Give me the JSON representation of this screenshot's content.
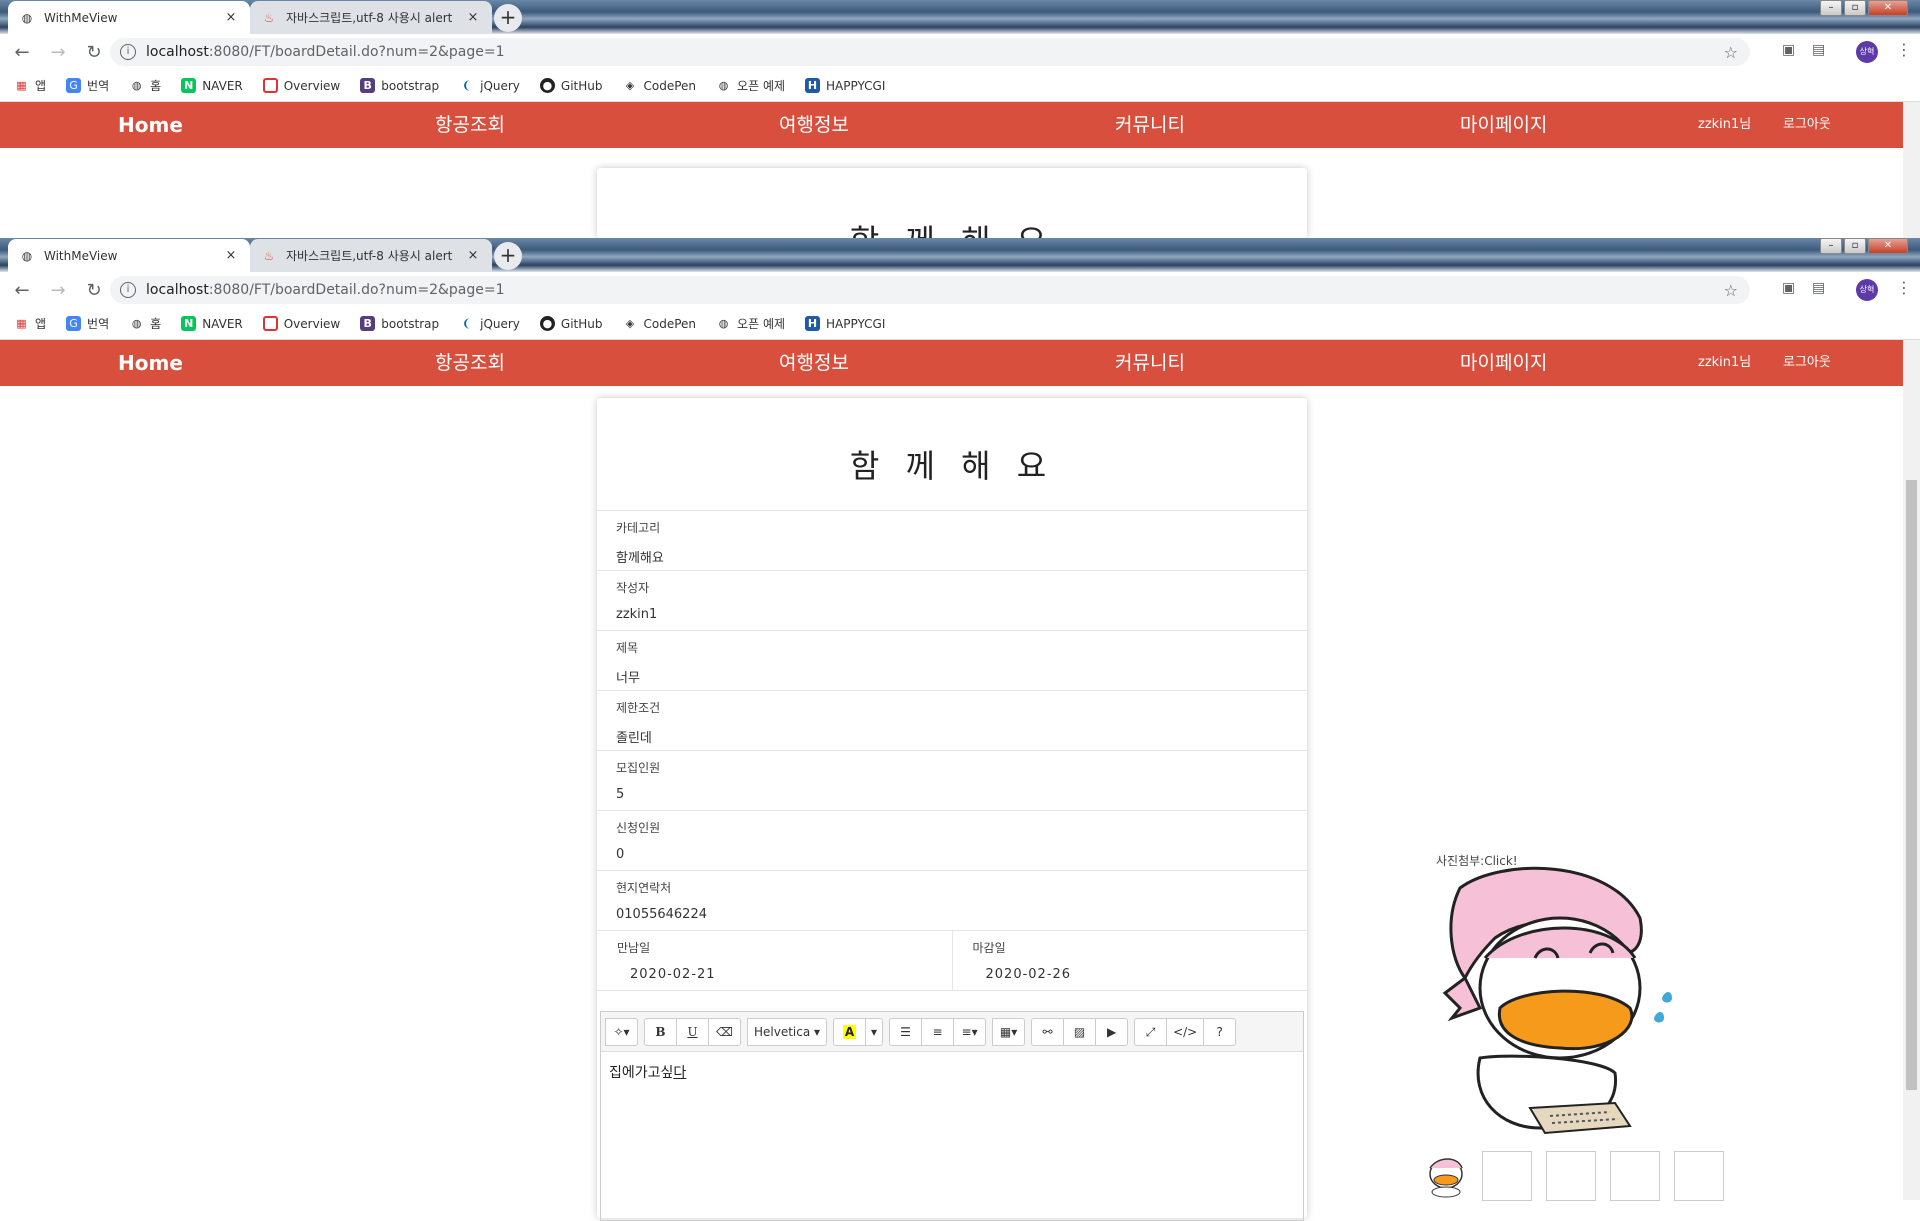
{
  "browser": {
    "tabs": [
      {
        "title": "WithMeView",
        "close": "×"
      },
      {
        "title": "자바스크립트,utf-8 사용시 alert",
        "close": "×"
      }
    ],
    "new_tab": "+",
    "url_host": "localhost",
    "url_path": ":8080/FT/boardDetail.do?num=2&page=1",
    "profile_initials": "상혁",
    "bookmarks": [
      {
        "label": "앱",
        "icon": "apps-grid-icon"
      },
      {
        "label": "번역",
        "icon": "translate-icon"
      },
      {
        "label": "홈",
        "icon": "globe-icon"
      },
      {
        "label": "NAVER",
        "icon": "naver-icon"
      },
      {
        "label": "Overview",
        "icon": "overview-icon"
      },
      {
        "label": "bootstrap",
        "icon": "bootstrap-icon"
      },
      {
        "label": "jQuery",
        "icon": "jquery-icon"
      },
      {
        "label": "GitHub",
        "icon": "github-icon"
      },
      {
        "label": "CodePen",
        "icon": "codepen-icon"
      },
      {
        "label": "오픈 예제",
        "icon": "globe-icon"
      },
      {
        "label": "HAPPYCGI",
        "icon": "happycgi-icon"
      }
    ]
  },
  "nav": {
    "home": "Home",
    "flights": "항공조회",
    "travel_info": "여행정보",
    "community": "커뮤니티",
    "mypage": "마이페이지",
    "user": "zzkin1님",
    "logout": "로그아웃",
    "color": "#d94f3d"
  },
  "card": {
    "title": "함 께 해 요",
    "fields": {
      "category": {
        "label": "카테고리",
        "value": "함께해요"
      },
      "author": {
        "label": "작성자",
        "value": "zzkin1"
      },
      "subject": {
        "label": "제목",
        "value": "너무"
      },
      "condition": {
        "label": "제한조건",
        "value": "졸린데"
      },
      "recruit": {
        "label": "모집인원",
        "value": "5"
      },
      "applied": {
        "label": "신청인원",
        "value": "0"
      },
      "contact": {
        "label": "현지연락처",
        "value": "01055646224"
      }
    },
    "meet_date": {
      "label": "만남일",
      "value": "2020-02-21"
    },
    "deadline": {
      "label": "마감일",
      "value": "2020-02-26"
    }
  },
  "editor": {
    "font_name": "Helvetica",
    "content_plain": "집에가고싶",
    "content_underlined": "다"
  },
  "photo": {
    "label": "사진첨부:Click!"
  }
}
